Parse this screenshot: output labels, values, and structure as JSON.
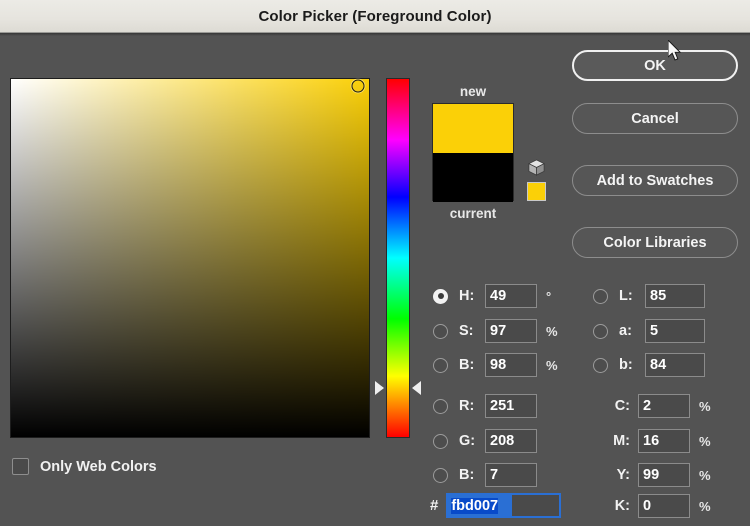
{
  "window": {
    "title": "Color Picker (Foreground Color)"
  },
  "colors": {
    "selected_hex": "fbd007",
    "new_color": "#fbd007",
    "current_color": "#000000",
    "websafe_color": "#fbd007",
    "dialog_background": "#535353",
    "titlebar_background": "#e8e6e0",
    "focus_blue": "#2a6fd4"
  },
  "preview": {
    "new_label": "new",
    "current_label": "current",
    "cube_icon_name": "out-of-web-gamut-cube-icon"
  },
  "options": {
    "only_web_colors_label": "Only Web Colors",
    "only_web_colors_checked": false
  },
  "buttons": {
    "ok": "OK",
    "cancel": "Cancel",
    "add_to_swatches": "Add to Swatches",
    "color_libraries": "Color Libraries"
  },
  "hsb": {
    "selected_channel": "H",
    "h": {
      "label": "H:",
      "value": "49",
      "unit": "°",
      "selected": true
    },
    "s": {
      "label": "S:",
      "value": "97",
      "unit": "%",
      "selected": false
    },
    "b": {
      "label": "B:",
      "value": "98",
      "unit": "%",
      "selected": false
    }
  },
  "lab": {
    "l": {
      "label": "L:",
      "value": "85",
      "selected": false
    },
    "a": {
      "label": "a:",
      "value": "5",
      "selected": false
    },
    "b": {
      "label": "b:",
      "value": "84",
      "selected": false
    }
  },
  "rgb": {
    "r": {
      "label": "R:",
      "value": "251",
      "selected": false
    },
    "g": {
      "label": "G:",
      "value": "208",
      "selected": false
    },
    "b": {
      "label": "B:",
      "value": "7",
      "selected": false
    }
  },
  "cmyk": {
    "c": {
      "label": "C:",
      "value": "2",
      "unit": "%"
    },
    "m": {
      "label": "M:",
      "value": "16",
      "unit": "%"
    },
    "y": {
      "label": "Y:",
      "value": "99",
      "unit": "%"
    },
    "k": {
      "label": "K:",
      "value": "0",
      "unit": "%"
    }
  },
  "hex": {
    "hash": "#",
    "value": "fbd007",
    "selected": true
  },
  "sb_field": {
    "marker_x_pct": 97,
    "marker_y_pct": 2
  },
  "hue_slider": {
    "hue_degrees": 49,
    "marker_y_pct": 86
  }
}
